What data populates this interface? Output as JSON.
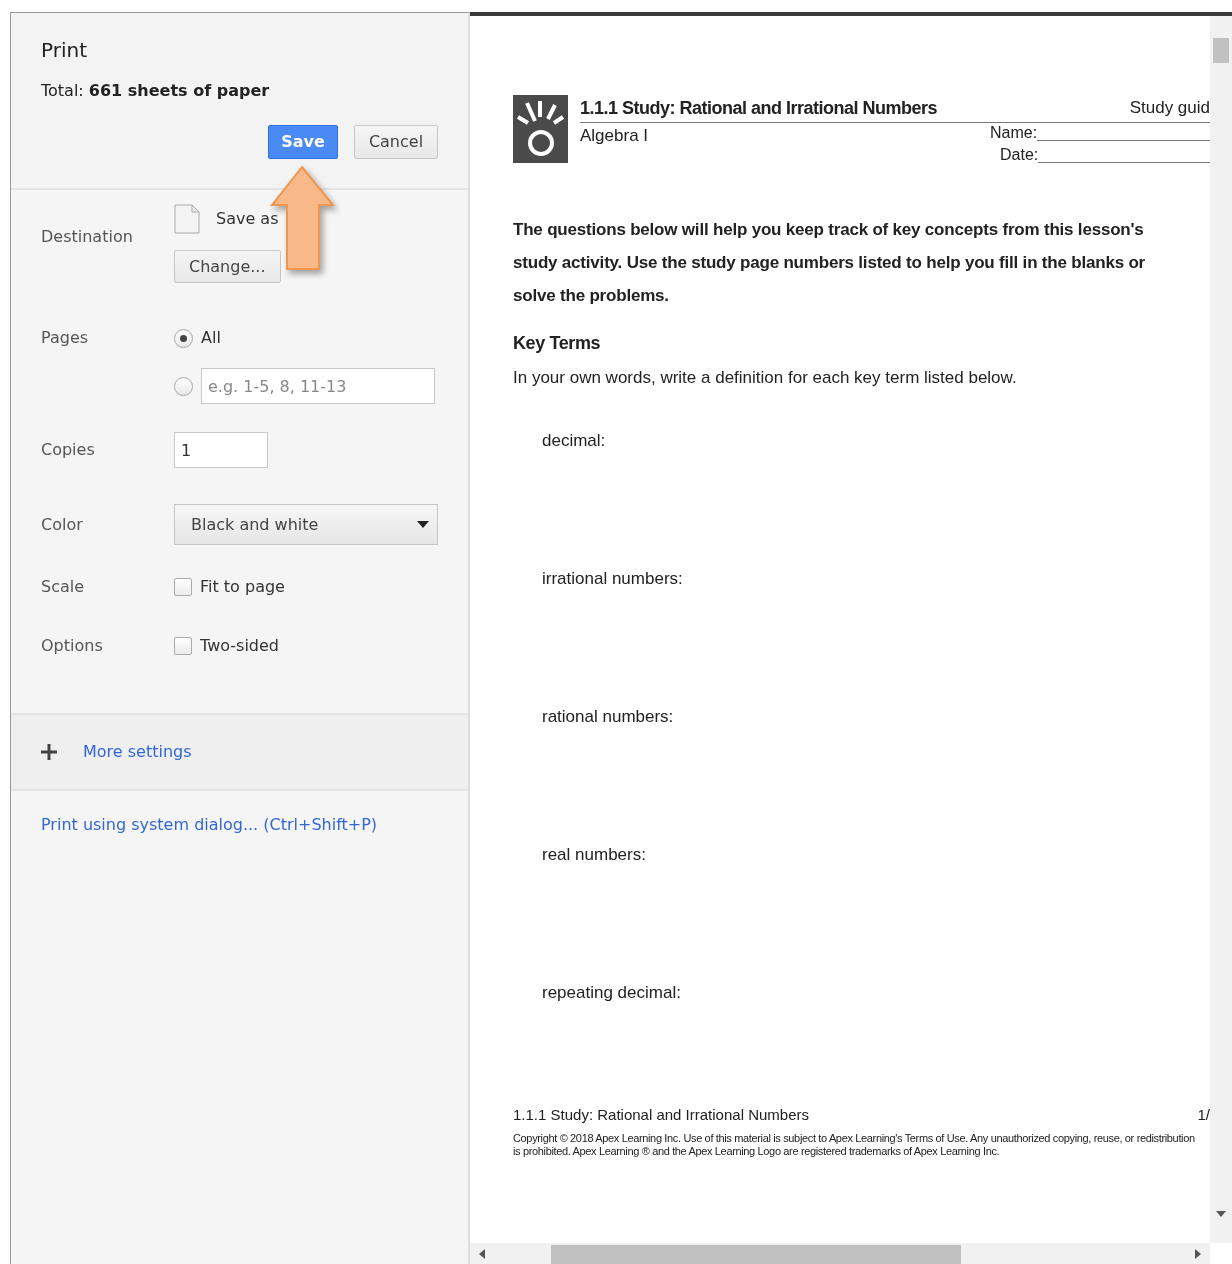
{
  "window": {
    "title": "Print"
  },
  "summary": {
    "label": "Total:",
    "value": "661 sheets of paper"
  },
  "buttons": [
    {
      "label": "Save",
      "kind": "primary"
    },
    {
      "label": "Cancel",
      "kind": "secondary"
    }
  ],
  "settings": [
    {
      "label": "Destination",
      "kind": "destination",
      "value": "Save as",
      "button": "Change..."
    },
    {
      "label": "Pages",
      "kind": "radios",
      "options": [
        {
          "label": "All",
          "selected": true
        },
        {
          "placeholder": "e.g. 1-5, 8, 11-13",
          "selected": false
        }
      ]
    },
    {
      "label": "Copies",
      "kind": "number",
      "value": "1"
    },
    {
      "label": "Color",
      "kind": "select",
      "value": "Black and white"
    },
    {
      "label": "Scale",
      "kind": "checkbox",
      "text": "Fit to page",
      "checked": false
    },
    {
      "label": "Options",
      "kind": "checkbox",
      "text": "Two-sided",
      "checked": false
    }
  ],
  "more_settings": {
    "label": "More settings",
    "expanded": false
  },
  "system_dialog_link": "Print using system dialog... (Ctrl+Shift+P)",
  "document": {
    "title": "1.1.1 Study: Rational and Irrational Numbers",
    "doc_type": "Study guid",
    "course": "Algebra I",
    "fields": [
      "Name:",
      "Date:"
    ],
    "intro": "The questions below will help you keep track of key concepts from this lesson's study activity. Use the study page numbers listed to help you fill in the blanks or solve the problems.",
    "section_title": "Key Terms",
    "instruction": "In your own words, write a definition for each key term listed below.",
    "terms": [
      "decimal:",
      "irrational numbers:",
      "rational numbers:",
      "real numbers:",
      "repeating decimal:"
    ],
    "footer_title": "1.1.1 Study: Rational and Irrational Numbers",
    "page_number": "1/",
    "copyright": "Copyright © 2018 Apex Learning Inc. Use of this material is subject to Apex Learning's Terms of Use. Any unauthorized copying, reuse, or redistribution is prohibited. Apex Learning ® and the Apex Learning Logo are registered trademarks of Apex Learning Inc."
  }
}
